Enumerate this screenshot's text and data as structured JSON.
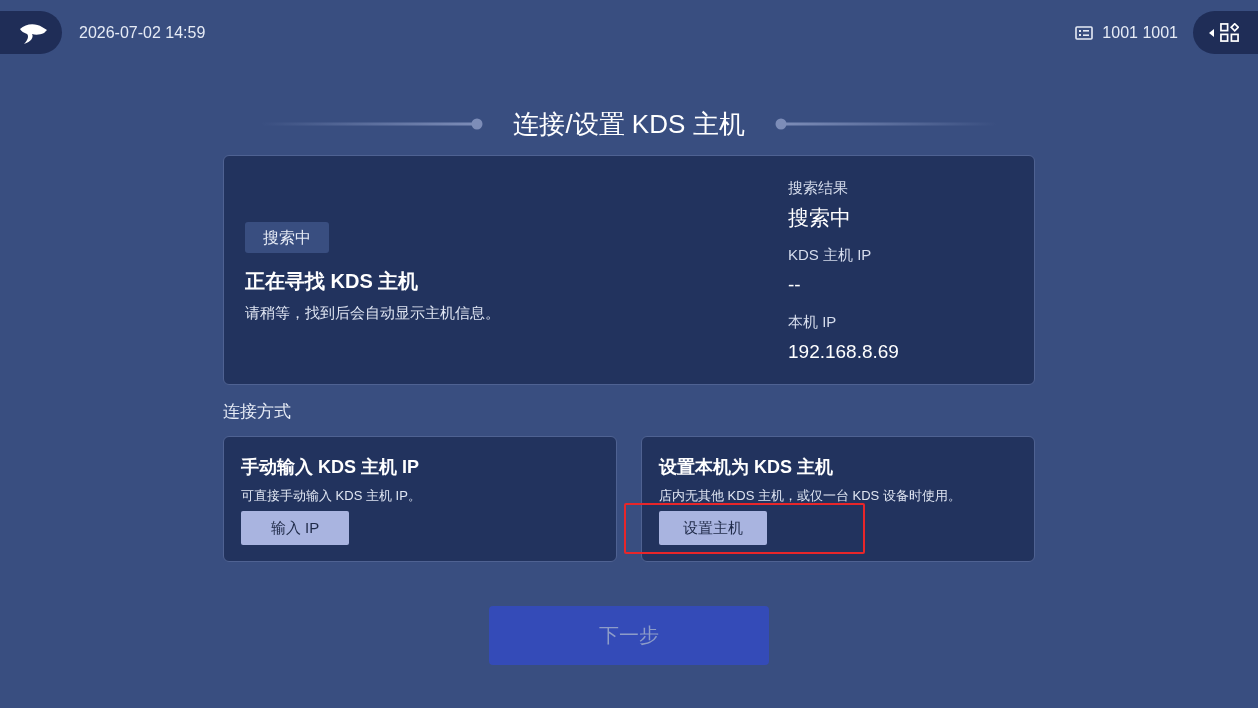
{
  "header": {
    "time": "2026-07-02 14:59",
    "device_id": "1001 1001"
  },
  "title": "连接/设置 KDS 主机",
  "search_card": {
    "badge": "搜索中",
    "heading": "正在寻找 KDS 主机",
    "description": "请稍等，找到后会自动显示主机信息。",
    "fields": [
      {
        "label": "搜索结果",
        "value": "搜索中"
      },
      {
        "label": "KDS 主机 IP",
        "value": "--"
      },
      {
        "label": "本机 IP",
        "value": "192.168.8.69"
      }
    ]
  },
  "connection": {
    "label": "连接方式",
    "options": [
      {
        "title": "手动输入 KDS 主机 IP",
        "description": "可直接手动输入 KDS 主机 IP。",
        "button": "输入 IP",
        "highlighted": false
      },
      {
        "title": "设置本机为 KDS 主机",
        "description": "店内无其他 KDS 主机，或仅一台 KDS 设备时使用。",
        "button": "设置主机",
        "highlighted": true
      }
    ]
  },
  "next_button": {
    "label": "下一步",
    "disabled": true
  }
}
